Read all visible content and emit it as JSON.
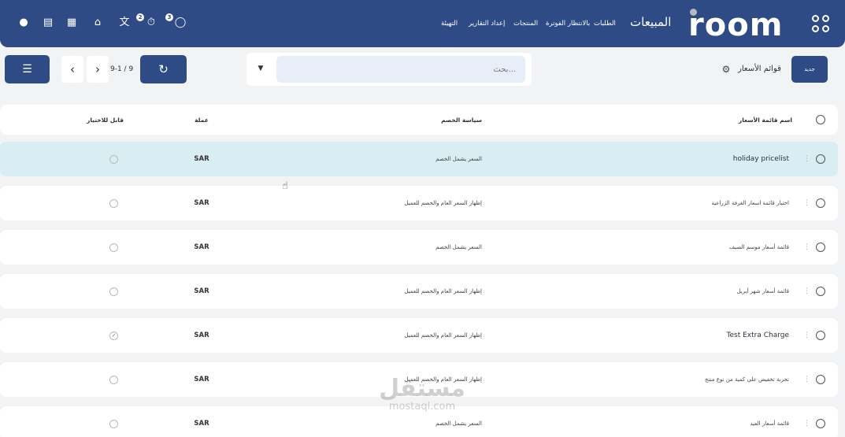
{
  "header": {
    "logo_text": "room",
    "app_title": "المبيعات",
    "nav": [
      "الطلبات",
      "بالانتظار الفوترة",
      "المنتجات",
      "إعداد التقارير",
      "التهيئة"
    ],
    "badges": {
      "activity": "3",
      "timer": "2"
    },
    "icons": [
      "chat-icon",
      "timer-icon",
      "translate-icon",
      "bank-icon",
      "calculator-icon",
      "note-icon",
      "lightbulb-icon",
      "apps-icon"
    ]
  },
  "control": {
    "new_label": "جديد",
    "breadcrumb": "قوائم الأسعار",
    "search_placeholder": "بحث...",
    "pager": "9-1 / 9"
  },
  "table": {
    "columns": {
      "name": "اسم قائمة الأسعار",
      "policy": "سياسة الخصم",
      "currency": "عملة",
      "selectable": "قابل للاختيار"
    },
    "rows": [
      {
        "name": "holiday pricelist",
        "policy": "السعر يشمل الخصم",
        "currency": "SAR",
        "selectable": false
      },
      {
        "name": "اختبار قائمة اسعار الغرفة الزراعية",
        "policy": "إظهار السعر العام والخصم للعميل",
        "currency": "SAR",
        "selectable": false
      },
      {
        "name": "قائمة أسعار موسم الصيف",
        "policy": "السعر يشمل الخصم",
        "currency": "SAR",
        "selectable": false
      },
      {
        "name": "قائمة أسعار شهر أبريل",
        "policy": "إظهار السعر العام والخصم للعميل",
        "currency": "SAR",
        "selectable": false
      },
      {
        "name": "Test Extra Charge",
        "policy": "إظهار السعر العام والخصم للعميل",
        "currency": "SAR",
        "selectable": true
      },
      {
        "name": "تجربة تخفيض على كمية من نوع منتج",
        "policy": "إظهار السعر العام والخصم للعميل",
        "currency": "SAR",
        "selectable": false
      },
      {
        "name": "قائمة أسعار العيد",
        "policy": "السعر يشمل الخصم",
        "currency": "SAR",
        "selectable": false
      }
    ]
  },
  "watermark": {
    "ar": "مستقل",
    "en": "mostaql.com"
  },
  "colors": {
    "primary": "#2f4b86",
    "active_row": "#d8eef3",
    "background": "#f2f3f5"
  }
}
